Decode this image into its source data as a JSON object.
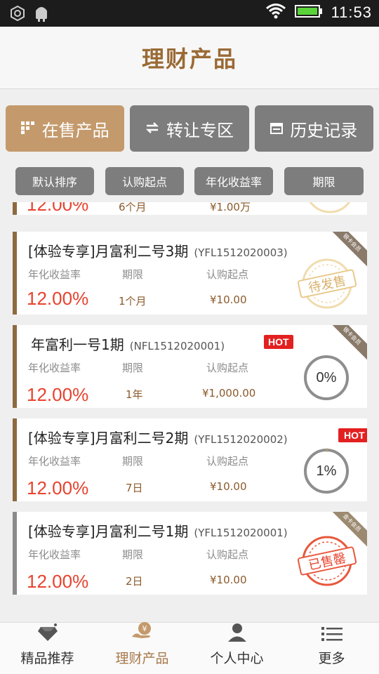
{
  "status_bar": {
    "time": "11:53"
  },
  "header": {
    "title": "理财产品"
  },
  "tabs": [
    {
      "label": "在售产品",
      "icon": "grid-icon",
      "active": true
    },
    {
      "label": "转让专区",
      "icon": "exchange-icon",
      "active": false
    },
    {
      "label": "历史记录",
      "icon": "calendar-icon",
      "active": false
    }
  ],
  "sorts": [
    "默认排序",
    "认购起点",
    "年化收益率",
    "期限"
  ],
  "partial_card": {
    "rate": "12.00%",
    "term": "6个月",
    "min": "¥1.00万"
  },
  "products": [
    {
      "name": "[体验专享]月富利二号3期",
      "code": "(YFL1512020003)",
      "rate_label": "年化收益率",
      "term_label": "期限",
      "min_label": "认购起点",
      "rate": "12.00%",
      "term": "1个月",
      "min": "¥10.00",
      "status": "待发售",
      "ribbon": "银卡会员"
    },
    {
      "name": "年富利一号1期",
      "code": "(NFL1512020001)",
      "hot": "HOT",
      "rate_label": "年化收益率",
      "term_label": "期限",
      "min_label": "认购起点",
      "rate": "12.00%",
      "term": "1年",
      "min": "¥1,000.00",
      "progress": "0%",
      "progress_value": 0,
      "ribbon": "银卡会员"
    },
    {
      "name": "[体验专享]月富利二号2期",
      "code": "(YFL1512020002)",
      "hot": "HOT",
      "rate_label": "年化收益率",
      "term_label": "期限",
      "min_label": "认购起点",
      "rate": "12.00%",
      "term": "7日",
      "min": "¥10.00",
      "progress": "1%",
      "progress_value": 0.01
    },
    {
      "name": "[体验专享]月富利二号1期",
      "code": "(YFL1512020001)",
      "rate_label": "年化收益率",
      "term_label": "期限",
      "min_label": "认购起点",
      "rate": "12.00%",
      "term": "2日",
      "min": "¥10.00",
      "status": "已售罄",
      "ribbon": "金卡会员"
    }
  ],
  "bottom_nav": [
    {
      "label": "精品推荐",
      "icon": "diamond-icon",
      "active": false
    },
    {
      "label": "理财产品",
      "icon": "money-bag-icon",
      "active": true
    },
    {
      "label": "个人中心",
      "icon": "person-icon",
      "active": false
    },
    {
      "label": "更多",
      "icon": "list-icon",
      "active": false
    }
  ],
  "colors": {
    "accent": "#c49a6c",
    "title": "#9a6a35",
    "rate": "#e8432e",
    "hot": "#e32020",
    "tab_inactive": "#7d7d7d"
  }
}
